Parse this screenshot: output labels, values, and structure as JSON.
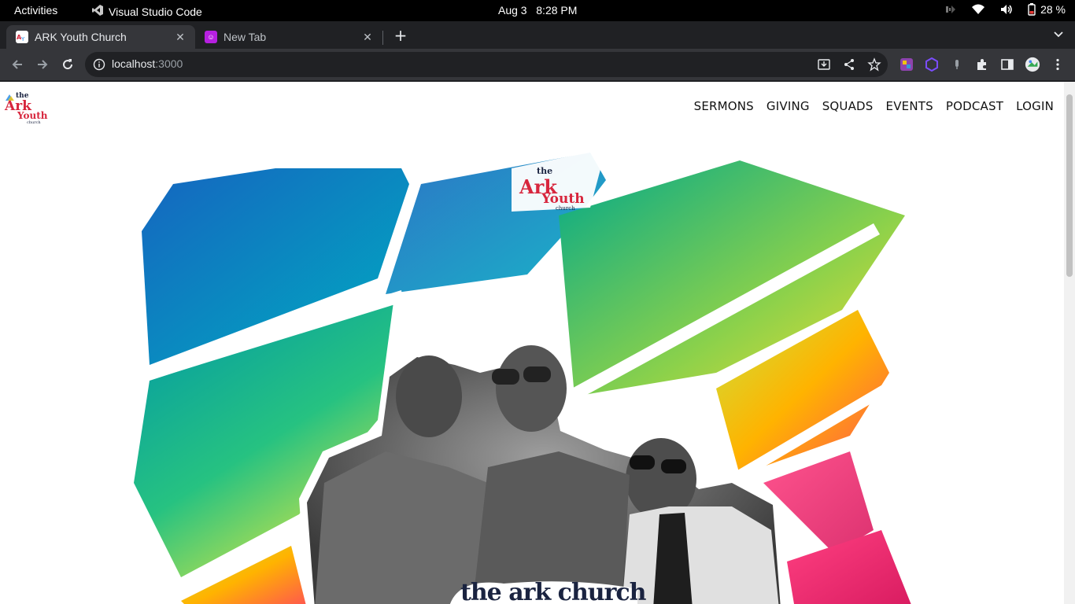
{
  "system_bar": {
    "activities": "Activities",
    "app_name": "Visual Studio Code",
    "date": "Aug 3",
    "time": "8:28 PM",
    "battery": "28 %"
  },
  "browser": {
    "tabs": [
      {
        "title": "ARK Youth Church",
        "active": true
      },
      {
        "title": "New Tab",
        "active": false
      }
    ],
    "url_host": "localhost",
    "url_port": ":3000"
  },
  "site": {
    "logo": {
      "line1": "the",
      "line2": "Ark",
      "line3": "Youth",
      "line4": "church"
    },
    "nav": [
      "SERMONS",
      "GIVING",
      "SQUADS",
      "EVENTS",
      "PODCAST",
      "LOGIN"
    ],
    "hero_caption": "the ark church"
  },
  "colors": {
    "accent_red": "#d7263d",
    "teal": "#1ab3a6",
    "blue": "#1e88e5",
    "yellow": "#f9c80e",
    "magenta": "#e91e63"
  }
}
